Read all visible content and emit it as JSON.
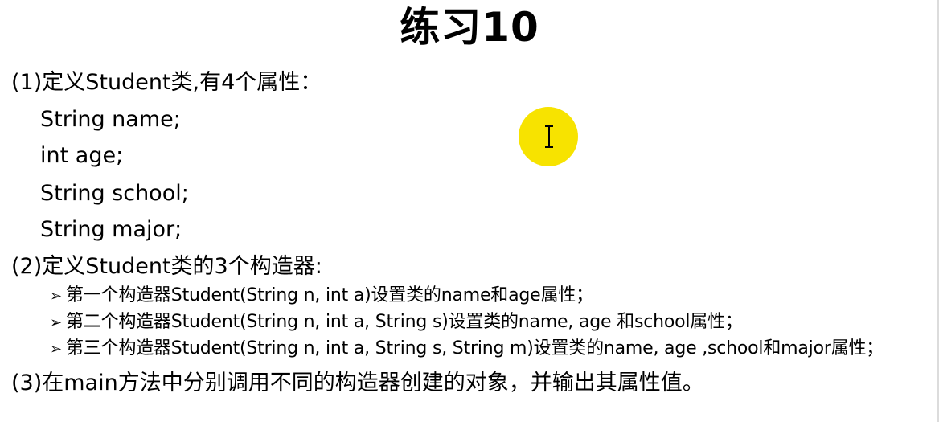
{
  "title": "练习10",
  "lines": {
    "p1": "(1)定义Student类,有4个属性：",
    "attr1": "String name;",
    "attr2": "int age;",
    "attr3": "String school;",
    "attr4": "String major;",
    "p2": "(2)定义Student类的3个构造器:",
    "c1": "第一个构造器Student(String n, int a)设置类的name和age属性；",
    "c2": "第二个构造器Student(String n, int a, String s)设置类的name, age 和school属性；",
    "c3": "第三个构造器Student(String n, int a, String s, String m)设置类的name, age ,school和major属性；",
    "p3": "(3)在main方法中分别调用不同的构造器创建的对象，并输出其属性值。"
  },
  "bullet_glyph": "➢",
  "icons": {
    "cursor": "text-cursor-icon",
    "highlight": "cursor-highlight-icon"
  },
  "colors": {
    "highlight": "#f7e300",
    "text": "#000000",
    "background": "#ffffff"
  }
}
